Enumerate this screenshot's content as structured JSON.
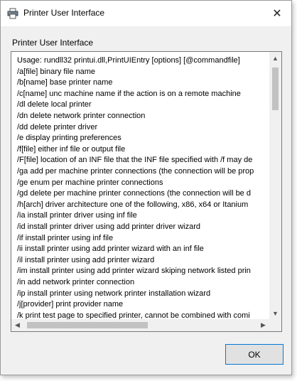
{
  "window": {
    "title": "Printer User Interface",
    "title_icon": "printer-icon",
    "close_glyph": "✕"
  },
  "group_label": "Printer User Interface",
  "usage_lines": [
    "Usage: rundll32 printui.dll,PrintUIEntry [options] [@commandfile]",
    "/a[file] binary file name",
    "/b[name] base printer name",
    "/c[name] unc machine name if the action is on a remote machine",
    "/dl delete local printer",
    "/dn delete network printer connection",
    "/dd delete printer driver",
    "/e display printing preferences",
    "/f[file] either inf file or output file",
    "/F[file] location of an INF file that the INF file specified with /f may de",
    "/ga add per machine printer connections (the connection will be prop",
    "/ge enum per machine printer connections",
    "/gd delete per machine printer connections (the connection will be d",
    "/h[arch] driver architecture one of the following, x86, x64 or Itanium",
    "/ia install printer driver using inf file",
    "/id install printer driver using add printer driver wizard",
    "/if install printer using inf file",
    "/ii install printer using add printer wizard with an inf file",
    "/il install printer using add printer wizard",
    "/im install printer using add printer wizard skiping network listed prin",
    "/in add network printer connection",
    "/ip install printer using network printer installation wizard",
    "/j[provider] print provider name",
    "/k print test page to specified printer, cannot be combined with comi"
  ],
  "scrollbar": {
    "up_glyph": "▲",
    "down_glyph": "▼",
    "left_glyph": "◀",
    "right_glyph": "▶"
  },
  "buttons": {
    "ok_label": "OK"
  }
}
